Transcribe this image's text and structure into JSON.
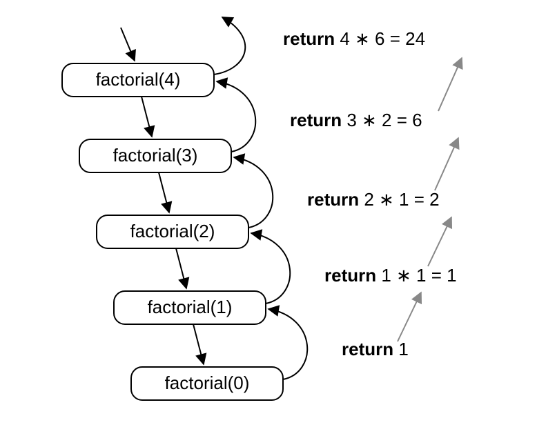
{
  "chart_data": {
    "type": "diagram",
    "title": "",
    "nodes": [
      {
        "id": "f4",
        "label": "factorial(4)"
      },
      {
        "id": "f3",
        "label": "factorial(3)"
      },
      {
        "id": "f2",
        "label": "factorial(2)"
      },
      {
        "id": "f1",
        "label": "factorial(1)"
      },
      {
        "id": "f0",
        "label": "factorial(0)"
      }
    ],
    "return_labels": [
      {
        "kw": "return",
        "expr": " 4 ∗ 6 = 24"
      },
      {
        "kw": "return",
        "expr": " 3 ∗ 2 = 6"
      },
      {
        "kw": "return",
        "expr": " 2 ∗ 1 = 2"
      },
      {
        "kw": "return",
        "expr": " 1 ∗ 1 = 1"
      },
      {
        "kw": "return",
        "expr": " 1"
      }
    ]
  }
}
